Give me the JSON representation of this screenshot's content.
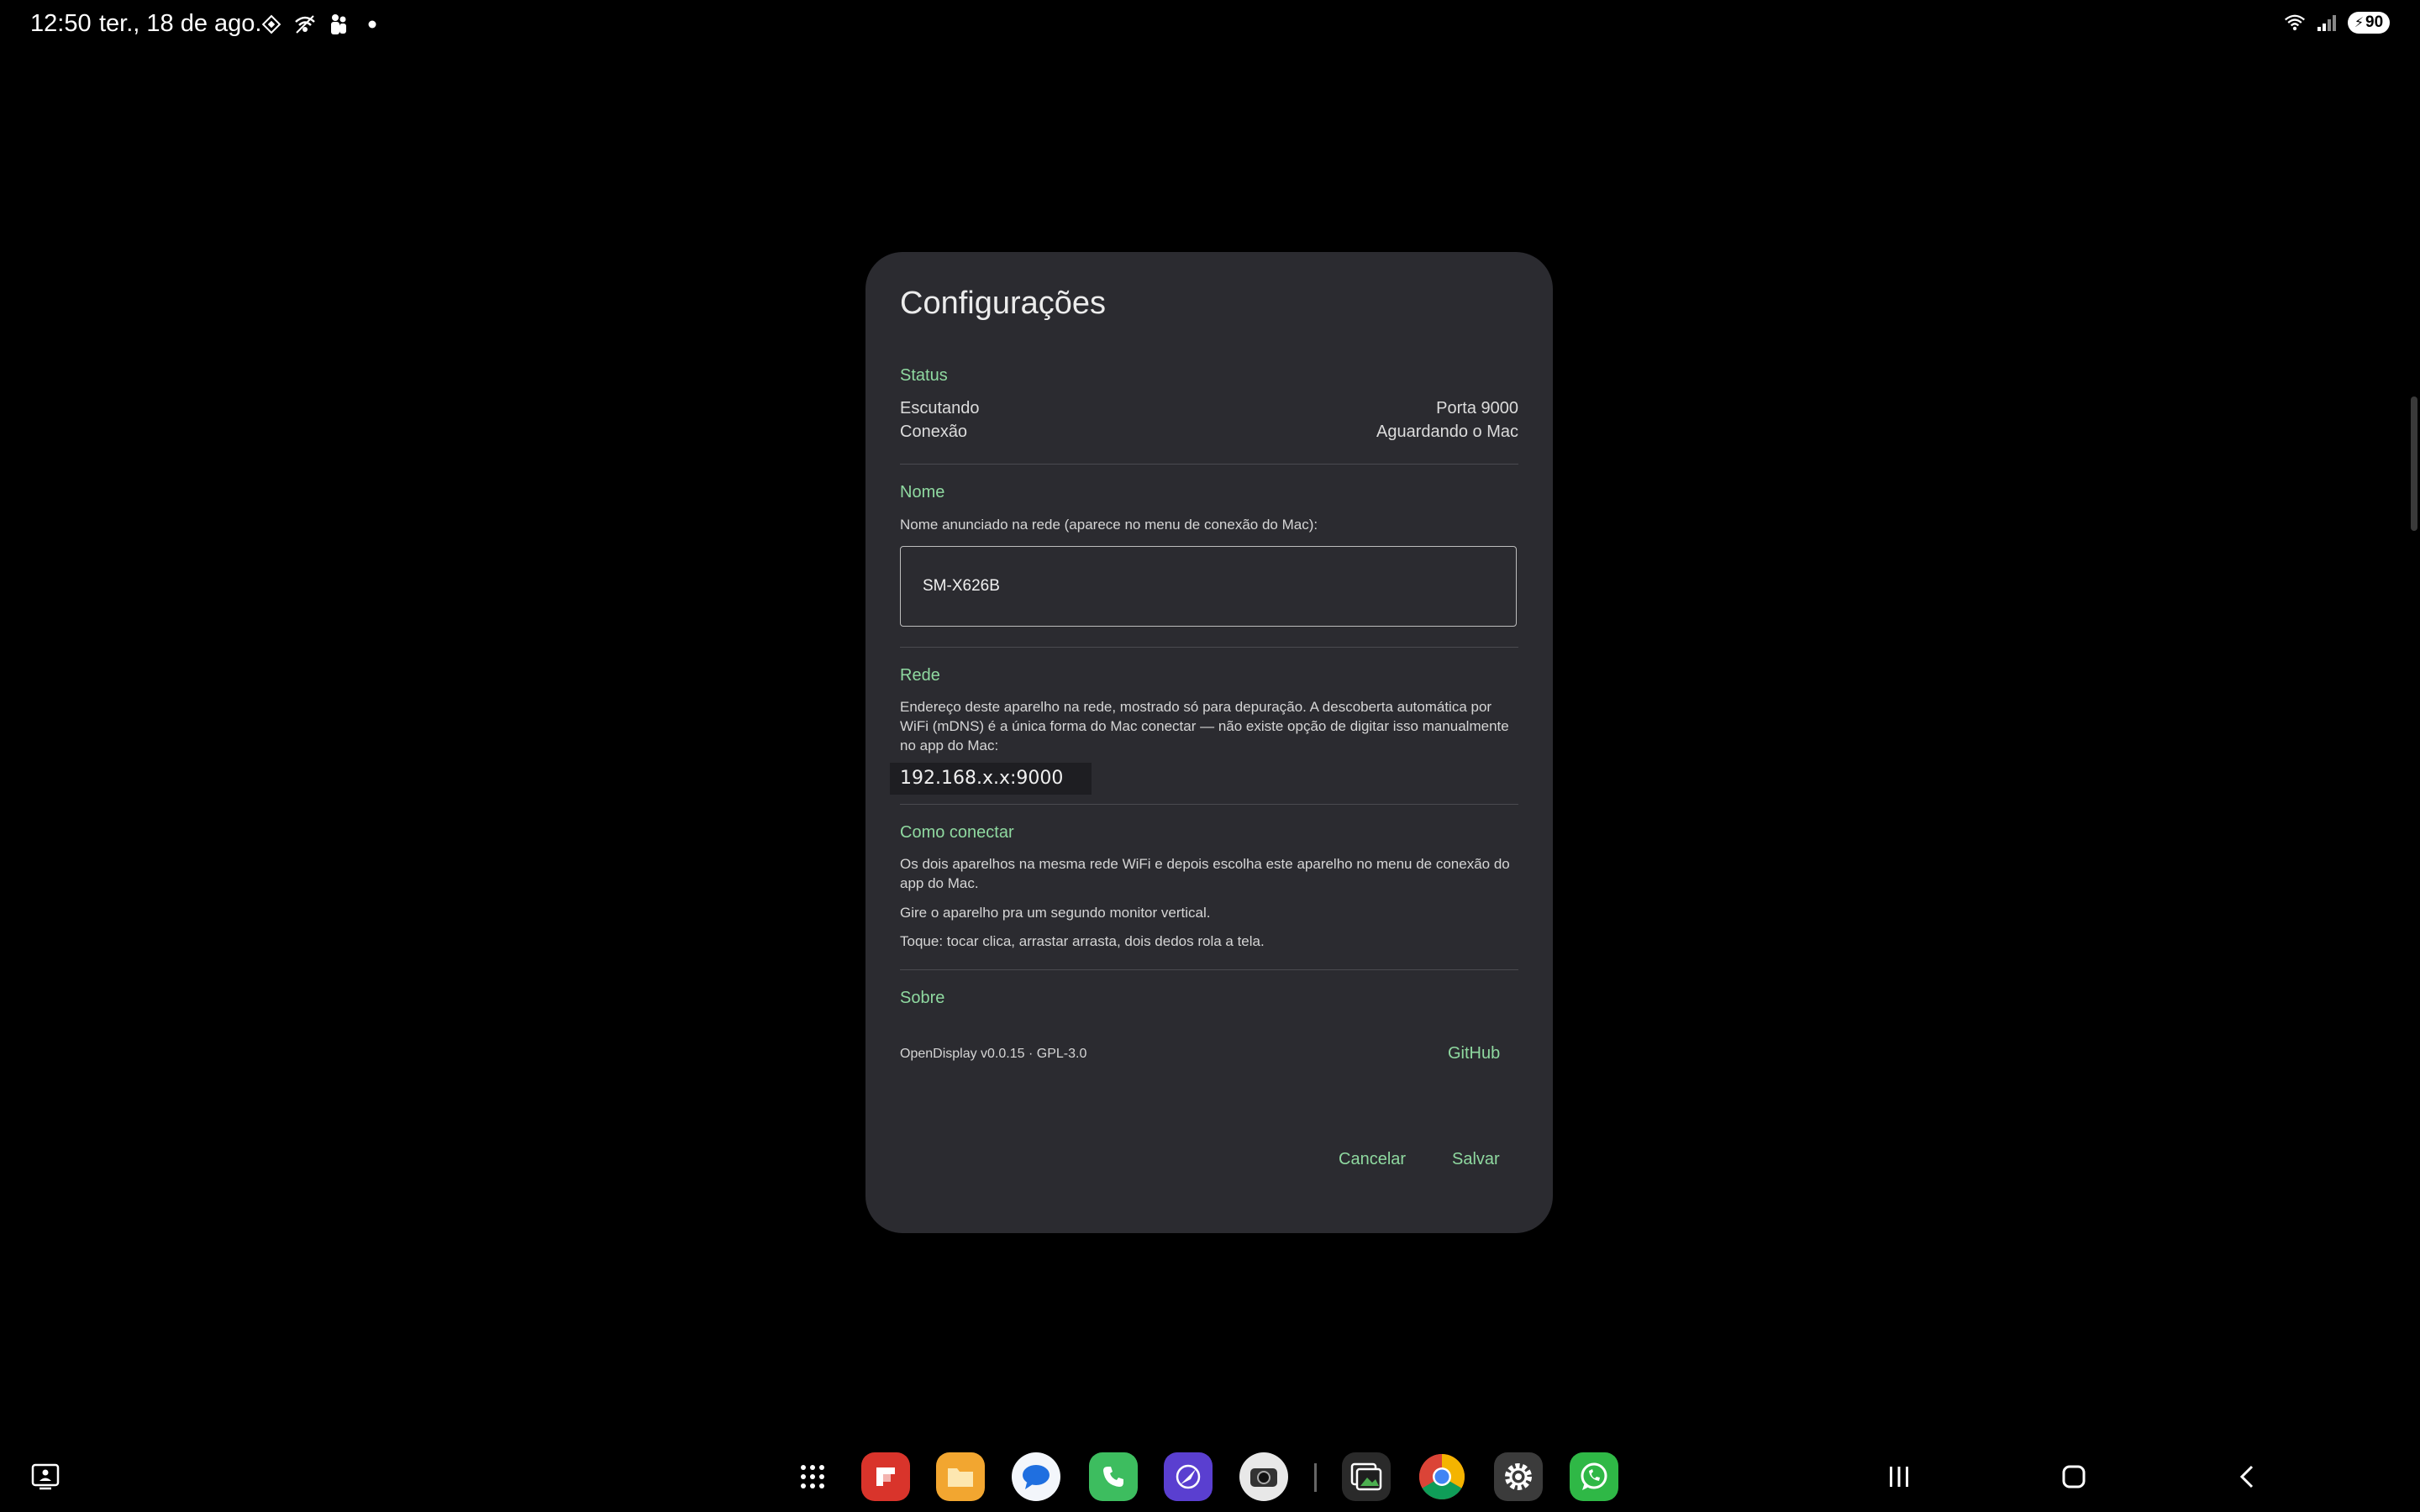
{
  "status_bar": {
    "time": "12:50",
    "date": "ter., 18 de ago.",
    "battery": "90"
  },
  "dialog": {
    "title": "Configurações",
    "status": {
      "label": "Status",
      "listening_label": "Escutando",
      "listening_value": "Porta 9000",
      "connection_label": "Conexão",
      "connection_value": "Aguardando o Mac"
    },
    "name": {
      "label": "Nome",
      "description": "Nome anunciado na rede (aparece no menu de conexão do Mac):",
      "value": "SM-X626B"
    },
    "network": {
      "label": "Rede",
      "description": "Endereço deste aparelho na rede, mostrado só para depuração. A descoberta automática por WiFi (mDNS) é a única forma do Mac conectar — não existe opção de digitar isso manualmente no app do Mac:",
      "address": "192.168.x.x:9000"
    },
    "how_to": {
      "label": "Como conectar",
      "step1": "Os dois aparelhos na mesma rede WiFi e depois escolha este aparelho no menu de conexão do app do Mac.",
      "step2": "Gire o aparelho pra um segundo monitor vertical.",
      "step3": "Toque: tocar clica, arrastar arrasta, dois dedos rola a tela."
    },
    "about": {
      "label": "Sobre",
      "version": "OpenDisplay v0.0.15 · GPL-3.0",
      "github_label": "GitHub"
    },
    "cancel_label": "Cancelar",
    "save_label": "Salvar"
  },
  "dock": {
    "apps": [
      "app-drawer",
      "flipboard",
      "files",
      "messages",
      "phone",
      "browser",
      "camera",
      "gallery",
      "chrome",
      "settings",
      "whatsapp"
    ]
  },
  "colors": {
    "accent": "#8fd9a0",
    "dialog_bg": "#2b2b30",
    "background": "#000000"
  }
}
